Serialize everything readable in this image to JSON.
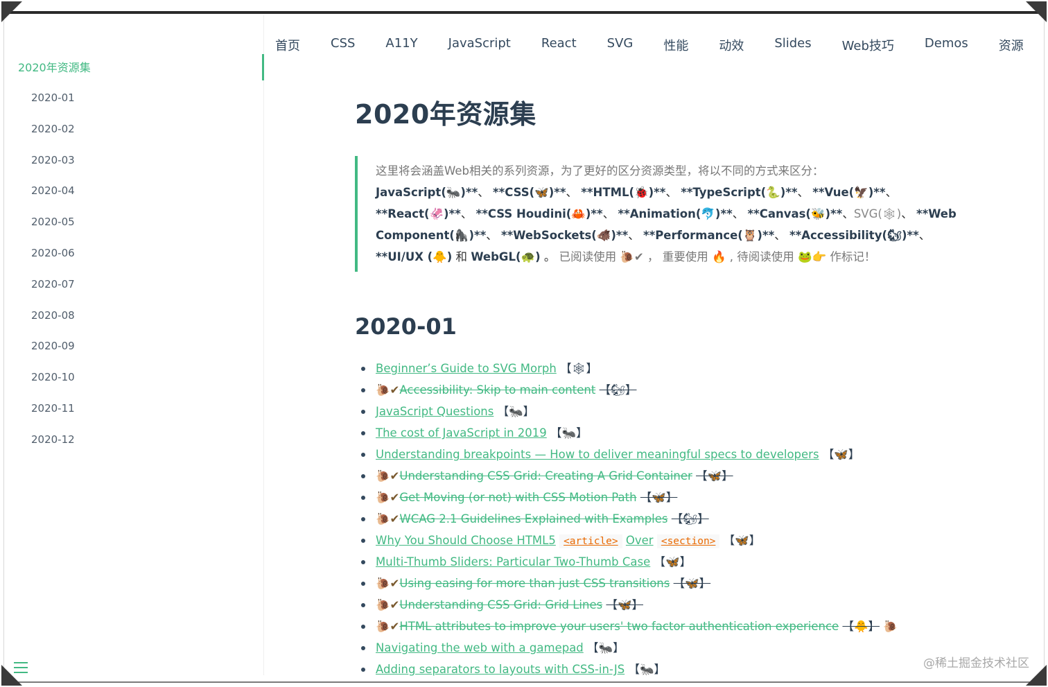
{
  "nav": {
    "items": [
      "首页",
      "CSS",
      "A11Y",
      "JavaScript",
      "React",
      "SVG",
      "性能",
      "动效",
      "Slides",
      "Web技巧",
      "Demos",
      "资源"
    ]
  },
  "sidebar": {
    "title": "2020年资源集",
    "items": [
      "2020-01",
      "2020-02",
      "2020-03",
      "2020-04",
      "2020-05",
      "2020-06",
      "2020-07",
      "2020-08",
      "2020-09",
      "2020-10",
      "2020-11",
      "2020-12"
    ]
  },
  "content": {
    "title": "2020年资源集",
    "quote": {
      "intro": "这里将会涵盖Web相关的系列资源，为了更好的区分资源类型，将以不同的方式来区分：",
      "tags": [
        {
          "label": "JavaScript(🐜)**",
          "sep": "、 "
        },
        {
          "label": "**CSS(🦋)**",
          "sep": "、 "
        },
        {
          "label": "**HTML(🐞)**",
          "sep": "、 "
        },
        {
          "label": "**TypeScript(🐍)**",
          "sep": "、 "
        },
        {
          "label": "**Vue(🦅)**",
          "sep": "、 "
        },
        {
          "label": "**React(🦑)**",
          "sep": "、 "
        },
        {
          "label": "**CSS Houdini(🦀)**",
          "sep": "、 "
        },
        {
          "label": "**Animation(🐬)**",
          "sep": "、 "
        },
        {
          "label": "**Canvas(🐝)**",
          "sep": "、"
        },
        {
          "label": "SVG(🕸)",
          "sep": "、 "
        },
        {
          "label": "**Web Component(🦍)**",
          "sep": "、 "
        },
        {
          "label": "**WebSockets(🐗)**",
          "sep": "、 "
        },
        {
          "label": "**Performance(🦉)**",
          "sep": "、 "
        },
        {
          "label": "**Accessibility(🐿)**",
          "sep": "、 "
        },
        {
          "label": "**UI/UX (🐥)",
          "sep": " 和 "
        },
        {
          "label": "WebGL(🐢)",
          "sep": " 。 "
        }
      ],
      "tail": "已阅读使用 🐌✔ ， 重要使用 🔥 , 待阅读使用 🐸👉 作标记！"
    },
    "section_title": "2020-01",
    "links": [
      {
        "prefix": "",
        "text": "Beginner’s Guide to SVG Morph",
        "mark": "【🕸】",
        "done": false
      },
      {
        "prefix": "🐌✔",
        "text": "Accessibility: Skip to main content",
        "mark": "【🐿】",
        "done": true
      },
      {
        "prefix": "",
        "text": "JavaScript Questions",
        "mark": "【🐜】",
        "done": false
      },
      {
        "prefix": "",
        "text": "The cost of JavaScript in 2019",
        "mark": "【🐜】",
        "done": false
      },
      {
        "prefix": "",
        "text": "Understanding breakpoints — How to deliver meaningful specs to developers",
        "mark": "【🦋】",
        "done": false
      },
      {
        "prefix": "🐌✔",
        "text": "Understanding CSS Grid: Creating A Grid Container",
        "mark": "【🦋】",
        "done": true
      },
      {
        "prefix": "🐌✔",
        "text": "Get Moving (or not) with CSS Motion Path",
        "mark": "【🦋】",
        "done": true
      },
      {
        "prefix": "🐌✔",
        "text": "WCAG 2.1 Guidelines Explained with Examples",
        "mark": "【🐿】",
        "done": true
      },
      {
        "prefix": "",
        "text": "Why You Should Choose HTML5",
        "code1": "<article>",
        "mid": "Over",
        "code2": "<section>",
        "mark": "【🦋】",
        "done": false
      },
      {
        "prefix": "",
        "text": "Multi-Thumb Sliders: Particular Two-Thumb Case",
        "mark": "【🦋】",
        "done": false
      },
      {
        "prefix": "🐌✔",
        "text": "Using easing for more than just CSS transitions",
        "mark": "【🦋】",
        "done": true
      },
      {
        "prefix": "🐌✔",
        "text": "Understanding CSS Grid: Grid Lines",
        "mark": "【🦋】",
        "done": true
      },
      {
        "prefix": "🐌✔",
        "text": "HTML attributes to improve your users' two factor authentication experience",
        "mark": "【🐥】",
        "suffix": "🐌",
        "done": true
      },
      {
        "prefix": "",
        "text": "Navigating the web with a gamepad",
        "mark": "【🐜】",
        "done": false
      },
      {
        "prefix": "",
        "text": "Adding separators to layouts with CSS-in-JS",
        "mark": "【🐜】",
        "done": false
      }
    ]
  },
  "watermark": "@稀土掘金技术社区",
  "colors": {
    "accent": "#42b983",
    "text": "#34495e",
    "code": "#e96900"
  }
}
